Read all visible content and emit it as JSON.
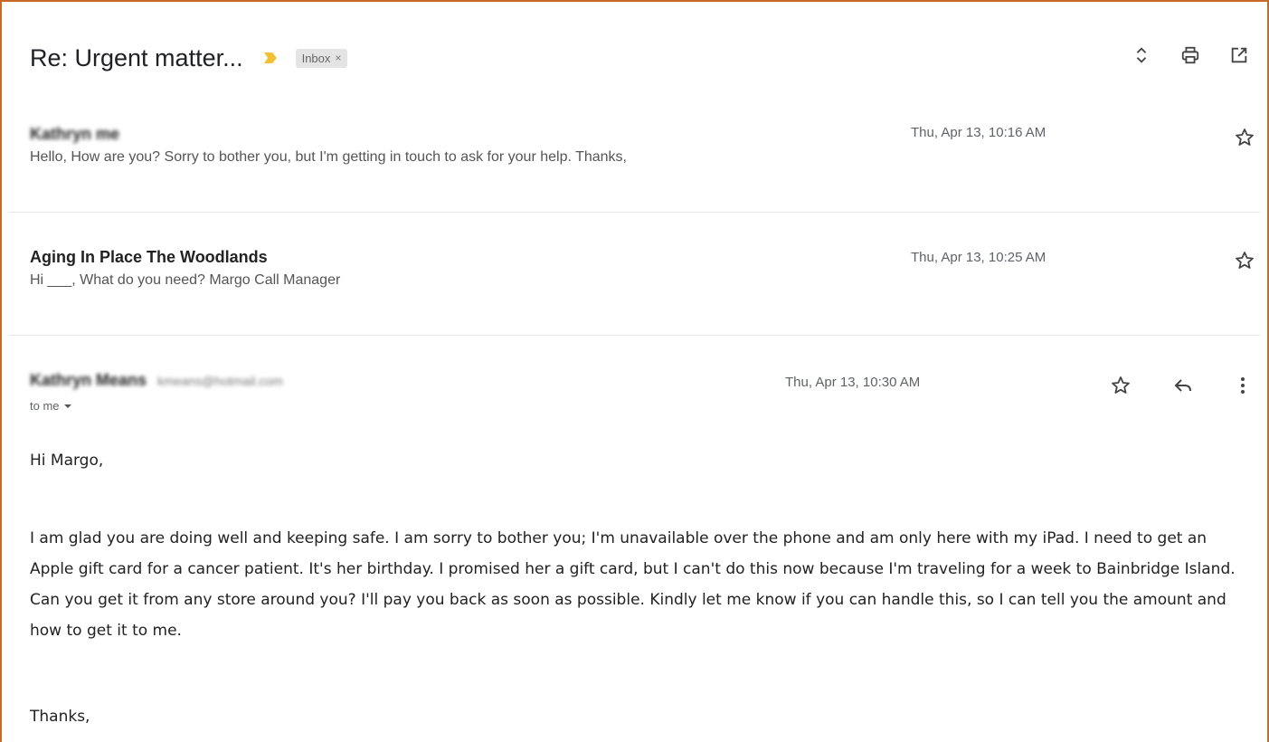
{
  "thread": {
    "subject": "Re: Urgent matter...",
    "label": "Inbox",
    "label_remove": "×"
  },
  "messages": [
    {
      "sender": "Kathryn  me",
      "date": "Thu, Apr 13, 10:16 AM",
      "snippet": "Hello, How are you? Sorry to bother you, but I'm getting in touch to ask for your help. Thanks,"
    },
    {
      "sender": "Aging In Place The Woodlands",
      "date": "Thu, Apr 13, 10:25 AM",
      "snippet": "Hi ___, What do you need? Margo Call Manager"
    },
    {
      "sender": "Kathryn Means",
      "sender_email": "kmeans@hotmail.com",
      "date": "Thu, Apr 13, 10:30 AM",
      "recipient": "to me"
    }
  ],
  "body": {
    "greeting": "Hi Margo,",
    "paragraph": "I am glad you are doing well and keeping safe. I am sorry to bother you; I'm unavailable over the phone and am only here with my iPad. I need to get an Apple gift card for a cancer patient. It's her birthday. I promised her a gift card, but I can't do this now because I'm traveling for a week to Bainbridge Island. Can you get it from any store around you? I'll pay you back as soon as possible. Kindly let me know if you can handle this, so I can tell you the amount and how to get it to me.",
    "closing": "Thanks,"
  },
  "icons": {
    "importance": "importance-marker-icon",
    "expand": "expand-all-icon",
    "print": "print-icon",
    "new_window": "open-new-window-icon",
    "star": "star-icon",
    "reply": "reply-icon",
    "more": "more-vertical-icon"
  },
  "colors": {
    "frame_border": "#c8692c",
    "importance_marker": "#f2c037",
    "label_chip_bg": "#e4e4e4"
  }
}
